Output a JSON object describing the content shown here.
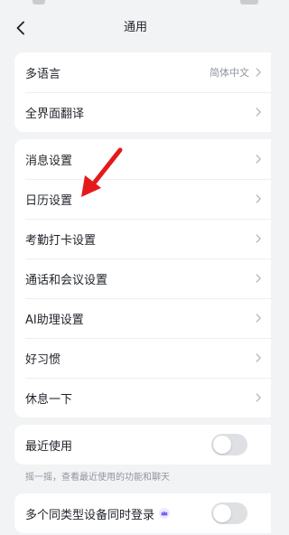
{
  "header": {
    "title": "通用"
  },
  "language_section": [
    {
      "label": "多语言",
      "value": "简体中文"
    },
    {
      "label": "全界面翻译"
    }
  ],
  "settings_section": [
    {
      "label": "消息设置"
    },
    {
      "label": "日历设置"
    },
    {
      "label": "考勤打卡设置"
    },
    {
      "label": "通话和会议设置"
    },
    {
      "label": "AI助理设置"
    },
    {
      "label": "好习惯"
    },
    {
      "label": "休息一下"
    }
  ],
  "recent_use": {
    "label": "最近使用",
    "enabled": false,
    "hint": "摇一摇，查看最近使用的功能和聊天"
  },
  "multi_device": {
    "label": "多个同类型设备同时登录",
    "enabled": false
  },
  "colors": {
    "accent_arrow": "#e4191c",
    "premium_badge": "#7b5cf5",
    "toggle_off": "#dee0e3"
  },
  "icons": {
    "back": "chevron-left-icon",
    "row_arrow": "chevron-right-icon",
    "premium": "crown-icon",
    "annotation": "red-arrow-icon"
  }
}
